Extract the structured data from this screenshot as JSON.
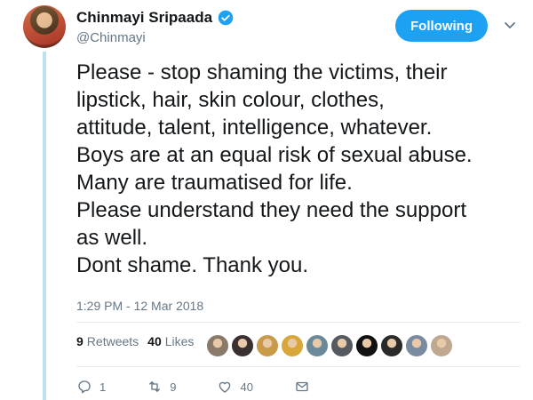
{
  "user": {
    "display_name": "Chinmayi Sripaada",
    "handle": "@Chinmayi",
    "verified": true
  },
  "follow_button": {
    "label": "Following"
  },
  "tweet": {
    "text": "Please - stop shaming the victims, their\nlipstick, hair, skin colour, clothes,\nattitude, talent, intelligence, whatever.\nBoys are at an equal risk of sexual abuse.\nMany are traumatised for life.\nPlease understand they need the support\nas well.\nDont shame. Thank you.",
    "timestamp": "1:29 PM - 12 Mar 2018"
  },
  "stats": {
    "retweets_count": "9",
    "retweets_label": "Retweets",
    "likes_count": "40",
    "likes_label": "Likes"
  },
  "likers": [
    {
      "icon": "avatar",
      "color": "#8a7a6a"
    },
    {
      "icon": "avatar",
      "color": "#3a3030"
    },
    {
      "icon": "avatar",
      "color": "#c89a4a"
    },
    {
      "icon": "avatar",
      "color": "#d9a63a"
    },
    {
      "icon": "avatar",
      "color": "#6a8a9a"
    },
    {
      "icon": "avatar",
      "color": "#555a60"
    },
    {
      "icon": "avatar",
      "color": "#111111"
    },
    {
      "icon": "avatar",
      "color": "#2a2a2a"
    },
    {
      "icon": "avatar",
      "color": "#7a8aa0"
    },
    {
      "icon": "avatar",
      "color": "#c0a890"
    }
  ],
  "actions": {
    "reply_count": "1",
    "retweet_count": "9",
    "like_count": "40"
  },
  "colors": {
    "accent": "#1da1f2",
    "muted": "#657786",
    "thread_line": "#bde3f2"
  }
}
